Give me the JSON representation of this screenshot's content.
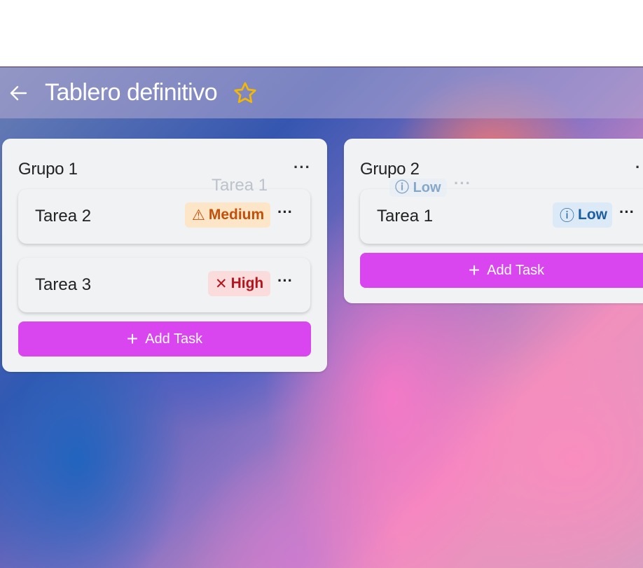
{
  "header": {
    "title": "Tablero definitivo",
    "back_icon": "arrow-left-icon",
    "favorite_icon": "star-icon",
    "star_color": "#f5b800"
  },
  "columns": [
    {
      "title": "Grupo 1",
      "menu": "···",
      "cards": [
        {
          "title": "Tarea 2",
          "priority": "Medium",
          "priority_icon": "⚠",
          "menu": "···"
        },
        {
          "title": "Tarea 3",
          "priority": "High",
          "priority_icon": "✕",
          "menu": "···"
        }
      ],
      "add_label": "Add Task"
    },
    {
      "title": "Grupo 2",
      "menu": "·",
      "cards": [
        {
          "title": "Tarea 1",
          "priority": "Low",
          "priority_icon": "ⓘ",
          "menu": "···"
        }
      ],
      "add_label": "Add Task"
    }
  ],
  "dragging_card": {
    "title": "Tarea 1",
    "priority": "Low",
    "priority_icon": "ⓘ",
    "menu": "···"
  },
  "colors": {
    "accent": "#d946ef",
    "medium": "#c2500b",
    "high": "#b4141e",
    "low": "#1d5f9e"
  }
}
